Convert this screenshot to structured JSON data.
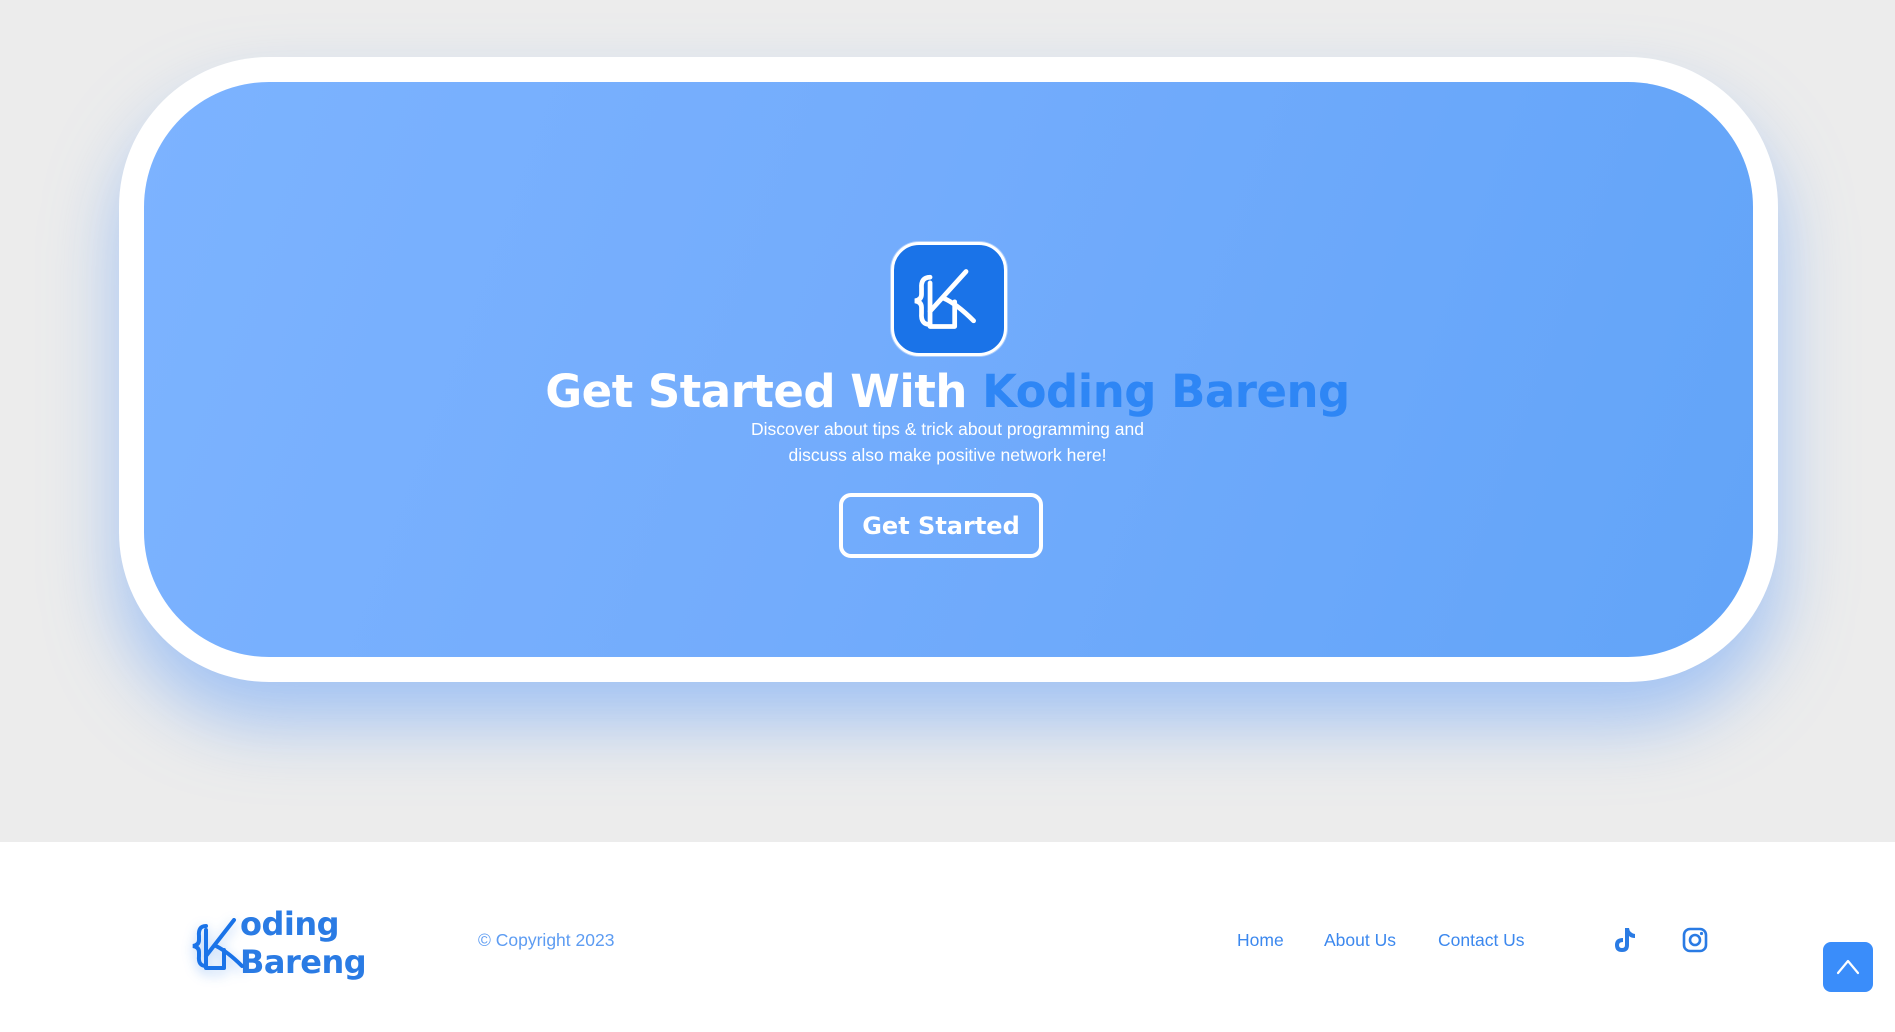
{
  "hero": {
    "title_main": "Get Started With ",
    "title_accent": "Koding Bareng",
    "description_line1": "Discover about tips & trick about programming and",
    "description_line2": "discuss also make positive network here!",
    "button_label": "Get Started",
    "logo_icon": "koding-bareng-logo-icon"
  },
  "footer": {
    "brand_text": "oding Bareng",
    "copyright": "© Copyright 2023",
    "nav": [
      {
        "label": "Home"
      },
      {
        "label": "About Us"
      },
      {
        "label": "Contact Us"
      }
    ],
    "social": [
      {
        "icon": "tiktok-icon"
      },
      {
        "icon": "instagram-icon"
      }
    ],
    "back_to_top_icon": "chevron-up-icon"
  },
  "colors": {
    "accent": "#2e86f5",
    "brand_blue": "#1a73e8",
    "hero_gradient_start": "#7cb3ff",
    "hero_gradient_end": "#62a4f8",
    "link": "#3c88ee",
    "background": "#ececec"
  }
}
